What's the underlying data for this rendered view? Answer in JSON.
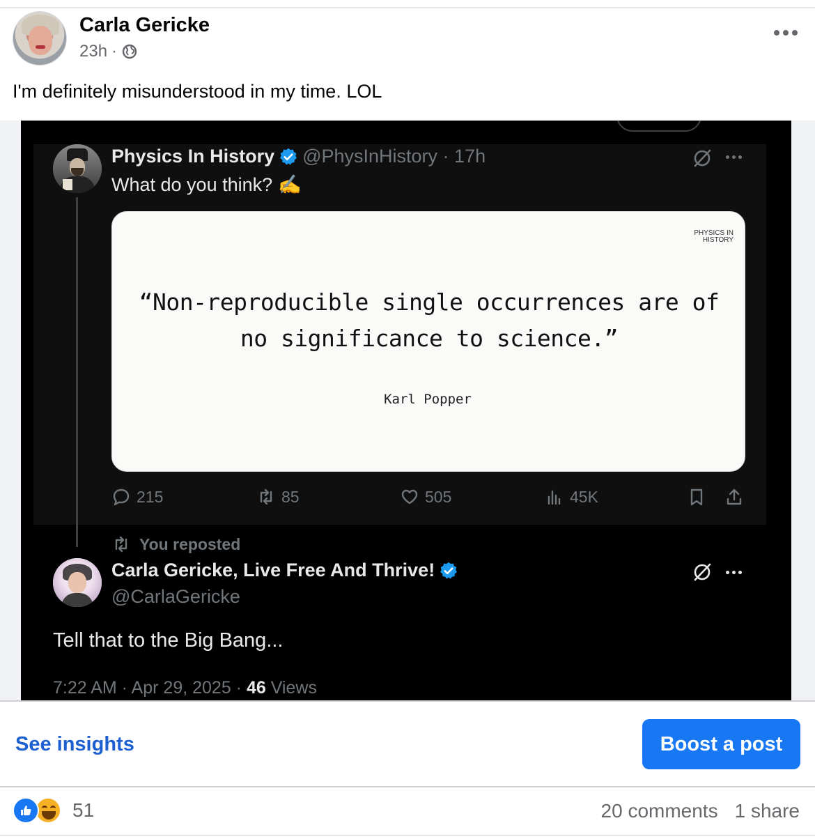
{
  "post": {
    "author": "Carla Gericke",
    "time": "23h",
    "separator": "·",
    "text": "I'm definitely misunderstood in my time. LOL"
  },
  "embedded_tweet": {
    "author_name": "Physics In History",
    "handle_time": "@PhysInHistory · 17h",
    "text": "What do you think?",
    "emoji": "✍️",
    "card": {
      "brand_line1": "PHYSICS IN",
      "brand_line2": "HISTORY",
      "quote": "“Non-reproducible single occurrences are of no significance to science.”",
      "author": "Karl Popper"
    },
    "actions": {
      "replies": "215",
      "reposts": "85",
      "likes": "505",
      "views": "45K"
    }
  },
  "repost": {
    "label": "You reposted",
    "author_name": "Carla Gericke, Live Free And Thrive!",
    "handle": "@CarlaGericke",
    "text": "Tell that to the Big Bang...",
    "timestamp": "7:22 AM · Apr 29, 2025 · ",
    "views_count": "46",
    "views_label": " Views"
  },
  "footer": {
    "insights_label": "See insights",
    "boost_label": "Boost a post",
    "reaction_count": "51",
    "comments": "20 comments",
    "shares": "1 share"
  },
  "colors": {
    "fb_blue": "#1877f2",
    "link_blue": "#1b5fd0",
    "x_verified": "#1d9bf0",
    "x_muted": "#71767b"
  },
  "icons": {
    "privacy": "globe-icon",
    "verified": "verified-badge-icon",
    "grok": "grok-icon",
    "reply": "reply-icon",
    "repost": "repost-icon",
    "like": "heart-icon",
    "views": "views-icon",
    "bookmark": "bookmark-icon",
    "share": "share-icon"
  }
}
